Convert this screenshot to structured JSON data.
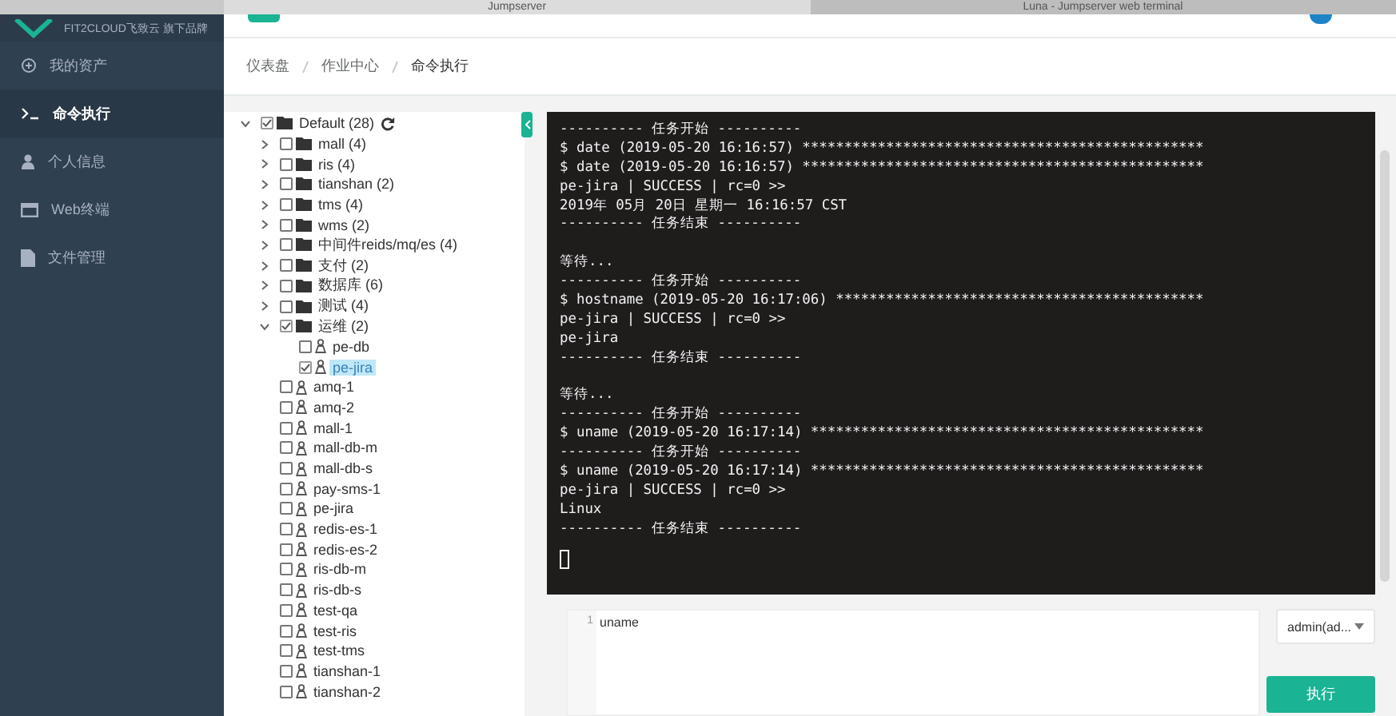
{
  "browser_tabs": [
    {
      "title": "Jumpserver",
      "selected": true
    },
    {
      "title": "Luna - Jumpserver web terminal",
      "selected": false
    }
  ],
  "sidebar": {
    "brand": "FIT2CLOUD飞致云 旗下品牌",
    "items": [
      {
        "label": "我的资产",
        "selected": false
      },
      {
        "label": "命令执行",
        "selected": true
      },
      {
        "label": "个人信息",
        "selected": false
      },
      {
        "label": "Web终端",
        "selected": false
      },
      {
        "label": "文件管理",
        "selected": false
      }
    ]
  },
  "breadcrumb": [
    "仪表盘",
    "作业中心",
    "命令执行"
  ],
  "tree": {
    "label": "Default (28)",
    "expanded": true,
    "checked": true,
    "children": [
      {
        "kind": "folder",
        "label": "mall (4)",
        "expanded": false,
        "checked": false,
        "selected": false
      },
      {
        "kind": "folder",
        "label": "ris (4)",
        "expanded": false,
        "checked": false,
        "selected": false
      },
      {
        "kind": "folder",
        "label": "tianshan (2)",
        "expanded": false,
        "checked": false,
        "selected": false
      },
      {
        "kind": "folder",
        "label": "tms (4)",
        "expanded": false,
        "checked": false,
        "selected": false
      },
      {
        "kind": "folder",
        "label": "wms (2)",
        "expanded": false,
        "checked": false,
        "selected": false
      },
      {
        "kind": "folder",
        "label": "中间件reids/mq/es (4)",
        "expanded": false,
        "checked": false,
        "selected": false
      },
      {
        "kind": "folder",
        "label": "支付 (2)",
        "expanded": false,
        "checked": false,
        "selected": false
      },
      {
        "kind": "folder",
        "label": "数据库 (6)",
        "expanded": false,
        "checked": false,
        "selected": false
      },
      {
        "kind": "folder",
        "label": "测试 (4)",
        "expanded": false,
        "checked": false,
        "selected": false
      },
      {
        "kind": "folder",
        "label": "运维 (2)",
        "expanded": true,
        "checked": true,
        "selected": false,
        "children": [
          {
            "kind": "host",
            "label": "pe-db",
            "checked": false,
            "selected": false
          },
          {
            "kind": "host",
            "label": "pe-jira",
            "checked": true,
            "selected": true
          }
        ]
      },
      {
        "kind": "host",
        "label": "amq-1",
        "checked": false,
        "selected": false
      },
      {
        "kind": "host",
        "label": "amq-2",
        "checked": false,
        "selected": false
      },
      {
        "kind": "host",
        "label": "mall-1",
        "checked": false,
        "selected": false
      },
      {
        "kind": "host",
        "label": "mall-db-m",
        "checked": false,
        "selected": false
      },
      {
        "kind": "host",
        "label": "mall-db-s",
        "checked": false,
        "selected": false
      },
      {
        "kind": "host",
        "label": "pay-sms-1",
        "checked": false,
        "selected": false
      },
      {
        "kind": "host",
        "label": "pe-jira",
        "checked": false,
        "selected": false
      },
      {
        "kind": "host",
        "label": "redis-es-1",
        "checked": false,
        "selected": false
      },
      {
        "kind": "host",
        "label": "redis-es-2",
        "checked": false,
        "selected": false
      },
      {
        "kind": "host",
        "label": "ris-db-m",
        "checked": false,
        "selected": false
      },
      {
        "kind": "host",
        "label": "ris-db-s",
        "checked": false,
        "selected": false
      },
      {
        "kind": "host",
        "label": "test-qa",
        "checked": false,
        "selected": false
      },
      {
        "kind": "host",
        "label": "test-ris",
        "checked": false,
        "selected": false
      },
      {
        "kind": "host",
        "label": "test-tms",
        "checked": false,
        "selected": false
      },
      {
        "kind": "host",
        "label": "tianshan-1",
        "checked": false,
        "selected": false
      },
      {
        "kind": "host",
        "label": "tianshan-2",
        "checked": false,
        "selected": false
      }
    ]
  },
  "terminal": {
    "blocks": [
      [
        "---------- 任务开始 ----------",
        "$ date (2019-05-20 16:16:57) ************************************************",
        "$ date (2019-05-20 16:16:57) ************************************************",
        "pe-jira | SUCCESS | rc=0 >>",
        "2019年 05月 20日 星期一 16:16:57 CST",
        "---------- 任务结束 ----------"
      ],
      [
        "等待...",
        "---------- 任务开始 ----------",
        "$ hostname (2019-05-20 16:17:06) ********************************************",
        "pe-jira | SUCCESS | rc=0 >>",
        "pe-jira",
        "---------- 任务结束 ----------"
      ],
      [
        "等待...",
        "---------- 任务开始 ----------",
        "$ uname (2019-05-20 16:17:14) ***********************************************",
        "---------- 任务开始 ----------",
        "$ uname (2019-05-20 16:17:14) ***********************************************",
        "pe-jira | SUCCESS | rc=0 >>",
        "Linux",
        "---------- 任务结束 ----------"
      ]
    ]
  },
  "editor": {
    "lines": [
      {
        "number": "1",
        "text": "uname"
      }
    ]
  },
  "user_select": {
    "value": "admin(ad..."
  },
  "run_button": "执行"
}
